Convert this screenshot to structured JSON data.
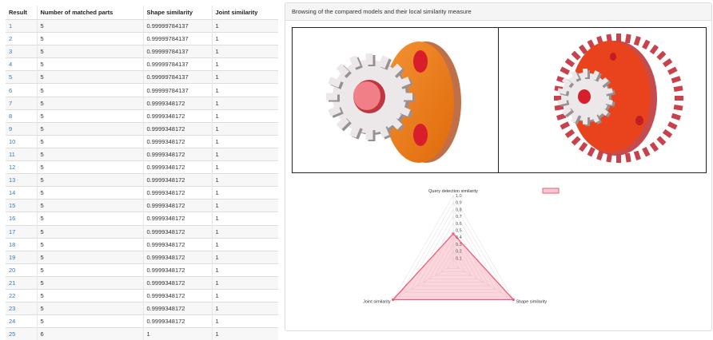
{
  "table": {
    "headers": [
      "Result",
      "Number of matched parts",
      "Shape similarity",
      "Joint similarity"
    ],
    "rows": [
      [
        "1",
        "5",
        "0.99999784137",
        "1"
      ],
      [
        "2",
        "5",
        "0.99999784137",
        "1"
      ],
      [
        "3",
        "5",
        "0.99999784137",
        "1"
      ],
      [
        "4",
        "5",
        "0.99999784137",
        "1"
      ],
      [
        "5",
        "5",
        "0.99999784137",
        "1"
      ],
      [
        "6",
        "5",
        "0.99999784137",
        "1"
      ],
      [
        "7",
        "5",
        "0.9999348172",
        "1"
      ],
      [
        "8",
        "5",
        "0.9999348172",
        "1"
      ],
      [
        "9",
        "5",
        "0.9999348172",
        "1"
      ],
      [
        "10",
        "5",
        "0.9999348172",
        "1"
      ],
      [
        "11",
        "5",
        "0.9999348172",
        "1"
      ],
      [
        "12",
        "5",
        "0.9999348172",
        "1"
      ],
      [
        "13",
        "5",
        "0.9999348172",
        "1"
      ],
      [
        "14",
        "5",
        "0.9999348172",
        "1"
      ],
      [
        "15",
        "5",
        "0.9999348172",
        "1"
      ],
      [
        "16",
        "5",
        "0.9999348172",
        "1"
      ],
      [
        "17",
        "5",
        "0.9999348172",
        "1"
      ],
      [
        "18",
        "5",
        "0.9999348172",
        "1"
      ],
      [
        "19",
        "5",
        "0.9999348172",
        "1"
      ],
      [
        "20",
        "5",
        "0.9999348172",
        "1"
      ],
      [
        "21",
        "5",
        "0.9999348172",
        "1"
      ],
      [
        "22",
        "5",
        "0.9999348172",
        "1"
      ],
      [
        "23",
        "5",
        "0.9999348172",
        "1"
      ],
      [
        "24",
        "5",
        "0.9999348172",
        "1"
      ],
      [
        "25",
        "6",
        "1",
        "1"
      ]
    ]
  },
  "panel": {
    "heading": "Browsing of the compared models and their local similarity measure"
  },
  "viewers": {
    "left_icon": "gear-assembly-model",
    "right_icon": "gear-assembly-model"
  },
  "colors": {
    "link": "#337ab7",
    "gear_face": "#f0ecee",
    "plate_orange": "#f07a14",
    "plate_red": "#e8431c",
    "radar_fill": "#f7a3b3",
    "radar_stroke": "#ef5a78"
  },
  "chart_data": {
    "type": "radar",
    "axes": [
      "Query detection similarity",
      "Shape similarity",
      "Joint similarity"
    ],
    "ticks": [
      "1.0",
      "0.9",
      "0.8",
      "0.7",
      "0.6",
      "0.5",
      "0.4",
      "0.3",
      "0.2",
      "0.1"
    ],
    "range": [
      0,
      1
    ],
    "series": [
      {
        "values": [
          0.45,
          1.0,
          1.0
        ]
      }
    ],
    "legend_position": "top-right"
  }
}
